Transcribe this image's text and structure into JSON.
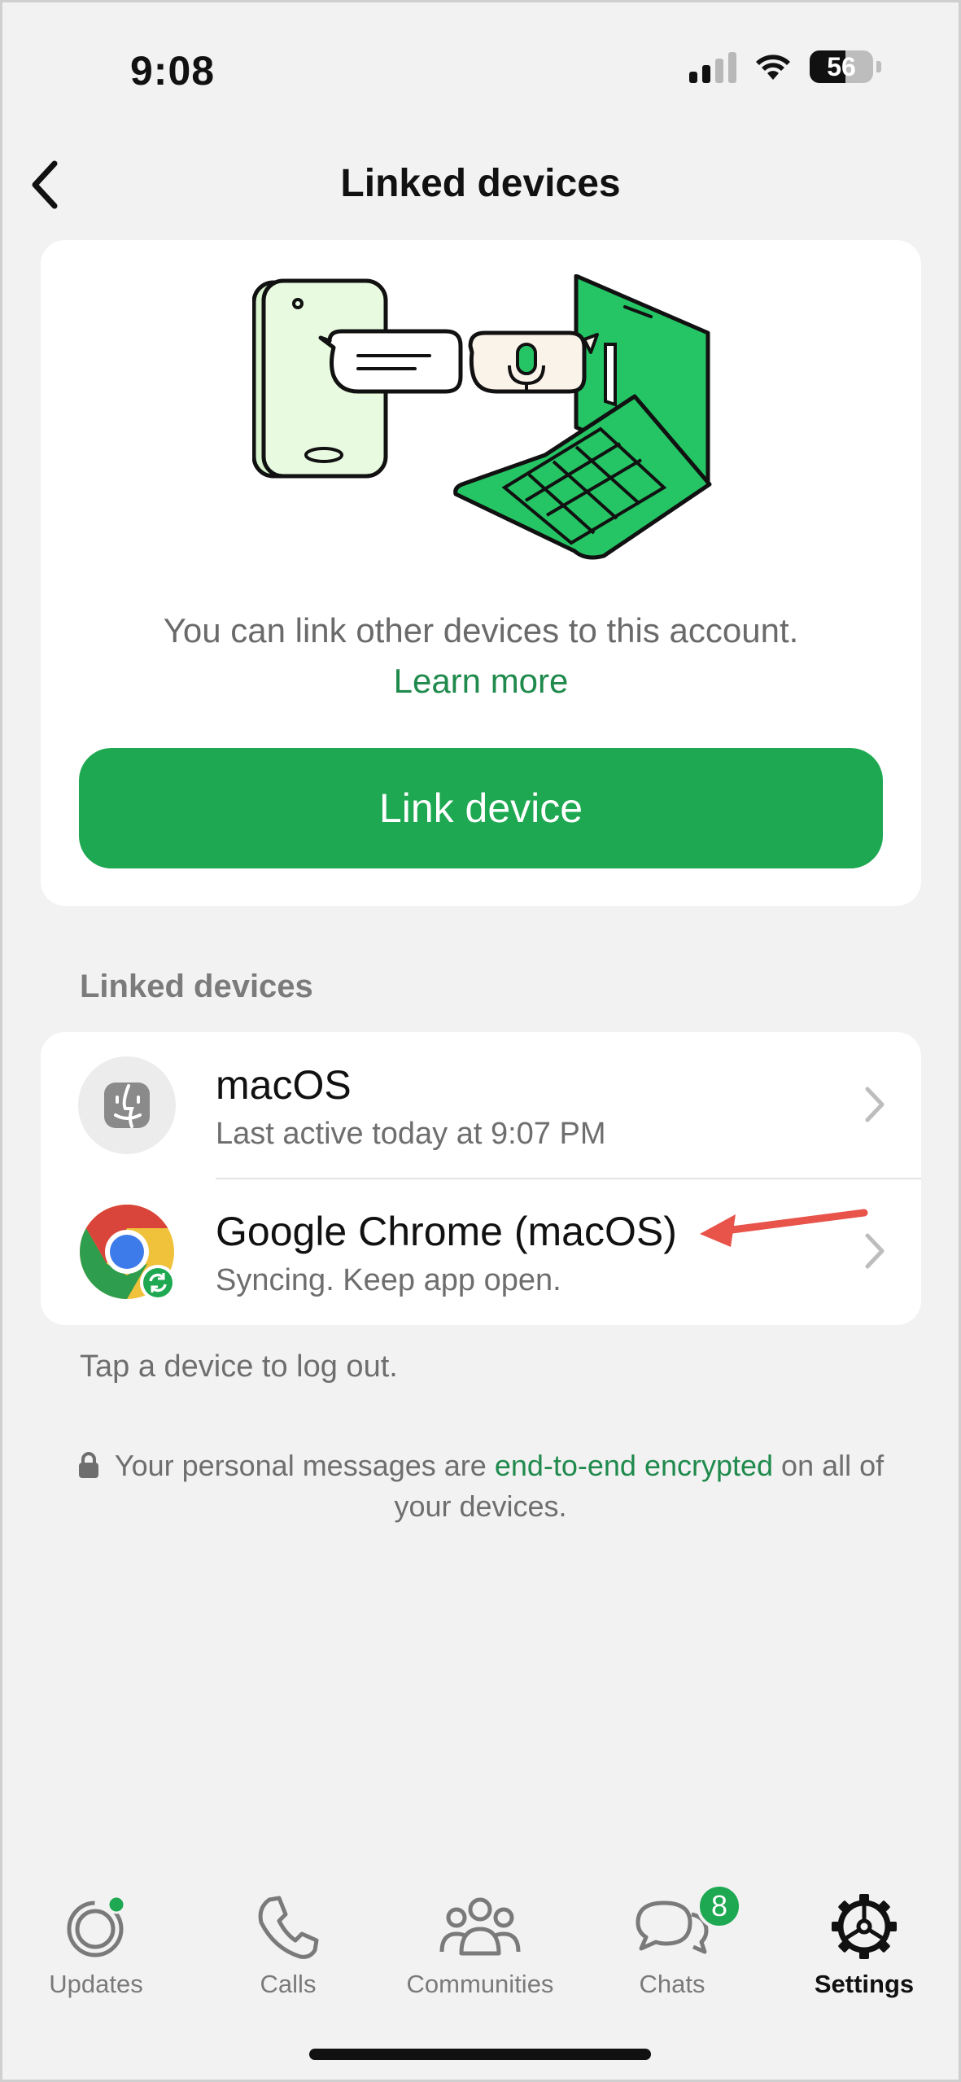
{
  "status_bar": {
    "time": "9:08",
    "battery": "56"
  },
  "nav": {
    "title": "Linked devices"
  },
  "hero": {
    "description": "You can link other devices to this account.",
    "learn_more": "Learn more",
    "button_label": "Link device"
  },
  "section_label": "Linked devices",
  "devices": [
    {
      "name": "macOS",
      "status": "Last active today at 9:07 PM",
      "icon": "macos-finder-icon"
    },
    {
      "name": "Google Chrome (macOS)",
      "status": "Syncing. Keep app open.",
      "icon": "chrome-icon"
    }
  ],
  "hint": "Tap a device to log out.",
  "encryption": {
    "prefix": "Your personal messages are ",
    "link": "end-to-end encrypted",
    "suffix": " on all of",
    "line2": "your devices."
  },
  "tabs": [
    {
      "label": "Updates",
      "icon": "updates-icon"
    },
    {
      "label": "Calls",
      "icon": "phone-icon"
    },
    {
      "label": "Communities",
      "icon": "communities-icon"
    },
    {
      "label": "Chats",
      "icon": "chats-icon",
      "badge": "8"
    },
    {
      "label": "Settings",
      "icon": "gear-icon",
      "active": true
    }
  ],
  "colors": {
    "accent": "#1da851",
    "link_green": "#1f8a4c",
    "annotation_arrow": "#e8534a"
  }
}
